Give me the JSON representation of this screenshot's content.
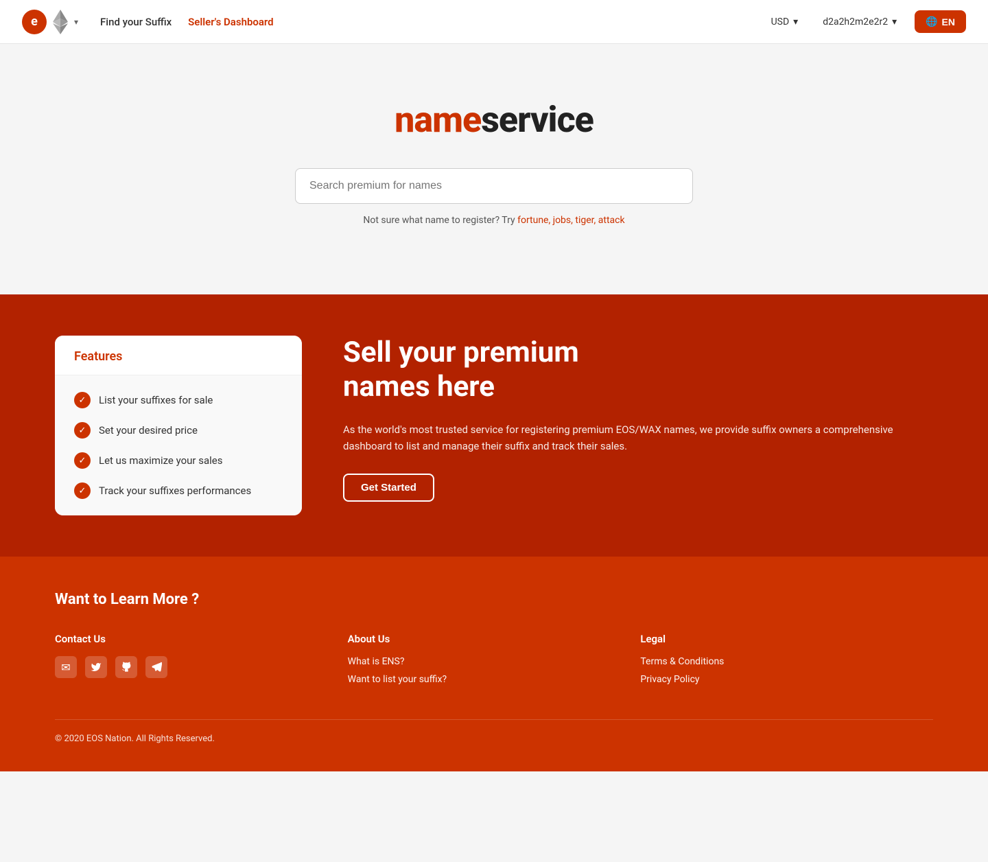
{
  "nav": {
    "eos_label": "e",
    "eth_label": "◇",
    "find_suffix": "Find your Suffix",
    "sellers_dashboard": "Seller's Dashboard",
    "currency": "USD",
    "account": "d2a2h2m2e2r2",
    "lang": "EN"
  },
  "hero": {
    "logo_name": "name",
    "logo_service": "service",
    "search_placeholder": "Search premium for names",
    "hint_text": "Not sure what name to register? Try ",
    "hint_links": [
      "fortune",
      "jobs",
      "tiger",
      "attack"
    ]
  },
  "features": {
    "card_title": "Features",
    "items": [
      "List your suffixes for sale",
      "Set your desired price",
      "Let us maximize your sales",
      "Track your suffixes performances"
    ]
  },
  "sell": {
    "heading_line1": "Sell your premium",
    "heading_line2": "names here",
    "description": "As the world's most trusted service for registering premium EOS/WAX names, we provide suffix owners a comprehensive dashboard to list and manage their suffix and track their sales.",
    "cta": "Get Started"
  },
  "footer": {
    "learn_more": "Want to Learn More ?",
    "contact_title": "Contact Us",
    "social": [
      {
        "icon": "✉",
        "name": "email"
      },
      {
        "icon": "🐦",
        "name": "twitter"
      },
      {
        "icon": "⌥",
        "name": "github"
      },
      {
        "icon": "✈",
        "name": "telegram"
      }
    ],
    "about_title": "About Us",
    "about_links": [
      "What is ENS?",
      "Want to list your suffix?"
    ],
    "legal_title": "Legal",
    "legal_links": [
      "Terms & Conditions",
      "Privacy Policy"
    ],
    "copyright": "© 2020 EOS Nation. All Rights Reserved."
  }
}
